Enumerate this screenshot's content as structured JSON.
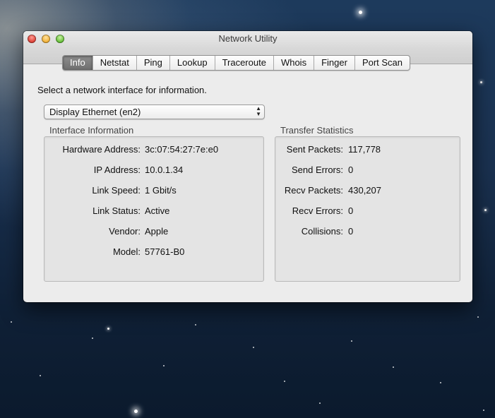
{
  "window": {
    "title": "Network Utility"
  },
  "tabs": [
    {
      "label": "Info",
      "active": true
    },
    {
      "label": "Netstat",
      "active": false
    },
    {
      "label": "Ping",
      "active": false
    },
    {
      "label": "Lookup",
      "active": false
    },
    {
      "label": "Traceroute",
      "active": false
    },
    {
      "label": "Whois",
      "active": false
    },
    {
      "label": "Finger",
      "active": false
    },
    {
      "label": "Port Scan",
      "active": false
    }
  ],
  "info": {
    "prompt": "Select a network interface for information.",
    "interface_select": {
      "value": "Display Ethernet (en2)"
    },
    "interface_information": {
      "title": "Interface Information",
      "rows": [
        {
          "label": "Hardware Address:",
          "value": "3c:07:54:27:7e:e0"
        },
        {
          "label": "IP Address:",
          "value": "10.0.1.34"
        },
        {
          "label": "Link Speed:",
          "value": "1 Gbit/s"
        },
        {
          "label": "Link Status:",
          "value": "Active"
        },
        {
          "label": "Vendor:",
          "value": "Apple"
        },
        {
          "label": "Model:",
          "value": "57761-B0"
        }
      ]
    },
    "transfer_statistics": {
      "title": "Transfer Statistics",
      "rows": [
        {
          "label": "Sent Packets:",
          "value": "117,778"
        },
        {
          "label": "Send Errors:",
          "value": "0"
        },
        {
          "label": "Recv Packets:",
          "value": "430,207"
        },
        {
          "label": "Recv Errors:",
          "value": "0"
        },
        {
          "label": "Collisions:",
          "value": "0"
        }
      ]
    }
  }
}
